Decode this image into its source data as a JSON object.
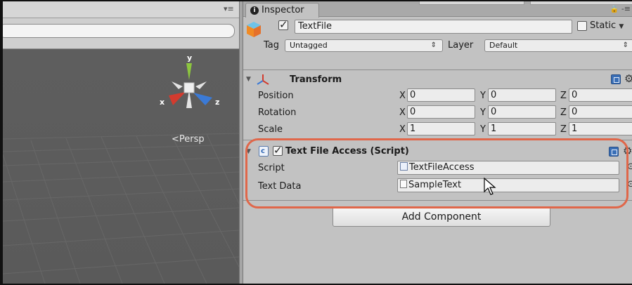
{
  "scene": {
    "pane_menu_icon": "pane-menu-icon",
    "gizmo_axes": {
      "y": "y",
      "x": "x",
      "z": "z"
    },
    "persp_label": "Persp",
    "persp_arrow": "<"
  },
  "inspector": {
    "tab_label": "Inspector",
    "lock_icon": "🔒",
    "menu_icon": "-≡",
    "game_object": {
      "active": true,
      "name": "TextFile",
      "static_label": "Static",
      "static_checked": false,
      "tag_label": "Tag",
      "tag_value": "Untagged",
      "layer_label": "Layer",
      "layer_value": "Default"
    },
    "transform": {
      "title": "Transform",
      "rows": [
        {
          "label": "Position",
          "x": "0",
          "y": "0",
          "z": "0"
        },
        {
          "label": "Rotation",
          "x": "0",
          "y": "0",
          "z": "0"
        },
        {
          "label": "Scale",
          "x": "1",
          "y": "1",
          "z": "1"
        }
      ],
      "axis_x": "X",
      "axis_y": "Y",
      "axis_z": "Z"
    },
    "script_component": {
      "enabled": true,
      "title": "Text File Access (Script)",
      "script_label": "Script",
      "script_value": "TextFileAccess",
      "text_data_label": "Text Data",
      "text_data_value": "SampleText"
    },
    "add_component_label": "Add Component"
  },
  "colors": {
    "highlight": "#e0674a",
    "scene_bg": "#595959",
    "inspector_bg": "#c2c2c2",
    "gizmo_x": "#d23b2e",
    "gizmo_y": "#8dc63f",
    "gizmo_z": "#3b7ad6"
  }
}
